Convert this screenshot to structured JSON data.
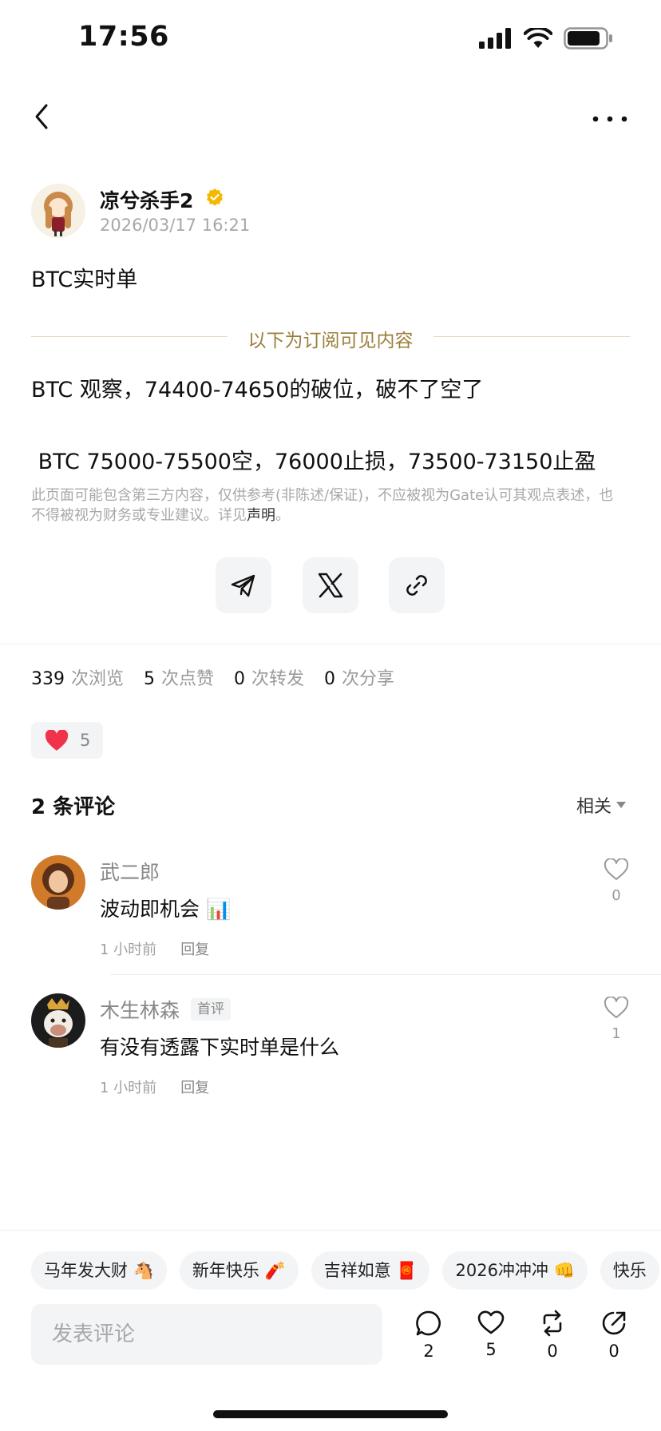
{
  "status_bar": {
    "time": "17:56"
  },
  "author": {
    "name": "凉兮杀手2",
    "date": "2026/03/17 16:21"
  },
  "post": {
    "title": "BTC实时单",
    "subscription_divider": "以下为订阅可见内容",
    "lines": [
      "BTC 观察，74400-74650的破位，破不了空了",
      " BTC 75000-75500空，76000止损，73500-73150止盈"
    ],
    "disclaimer_text": "此页面可能包含第三方内容，仅供参考(非陈述/保证)，不应被视为Gate认可其观点表述，也不得被视为财务或专业建议。详见",
    "disclaimer_link": "声明",
    "disclaimer_end": "。"
  },
  "share_buttons": [
    "telegram-icon",
    "x-icon",
    "link-icon"
  ],
  "stats": {
    "views": "339",
    "views_label": "次浏览",
    "likes": "5",
    "likes_label": "次点赞",
    "reposts": "0",
    "reposts_label": "次转发",
    "shares": "0",
    "shares_label": "次分享"
  },
  "reaction": {
    "count": "5",
    "color": "#f0334b"
  },
  "comments": {
    "header": "2 条评论",
    "sort": "相关",
    "items": [
      {
        "name": "武二郎",
        "tag": "",
        "text": "波动即机会 📊",
        "time": "1 小时前",
        "reply": "回复",
        "likes": "0"
      },
      {
        "name": "木生林森",
        "tag": "首评",
        "text": "有没有透露下实时单是什么",
        "time": "1 小时前",
        "reply": "回复",
        "likes": "1"
      }
    ]
  },
  "quick_replies": [
    "马年发大财 🐴",
    "新年快乐 🧨",
    "吉祥如意 🧧",
    "2026冲冲冲 👊",
    "快乐"
  ],
  "bottom_bar": {
    "input_placeholder": "发表评论",
    "comment_count": "2",
    "like_count": "5",
    "repost_count": "0",
    "share_count": "0"
  },
  "colors": {
    "gold": "#9c7f3b",
    "verified": "#f5b800",
    "heart": "#f0334b"
  }
}
